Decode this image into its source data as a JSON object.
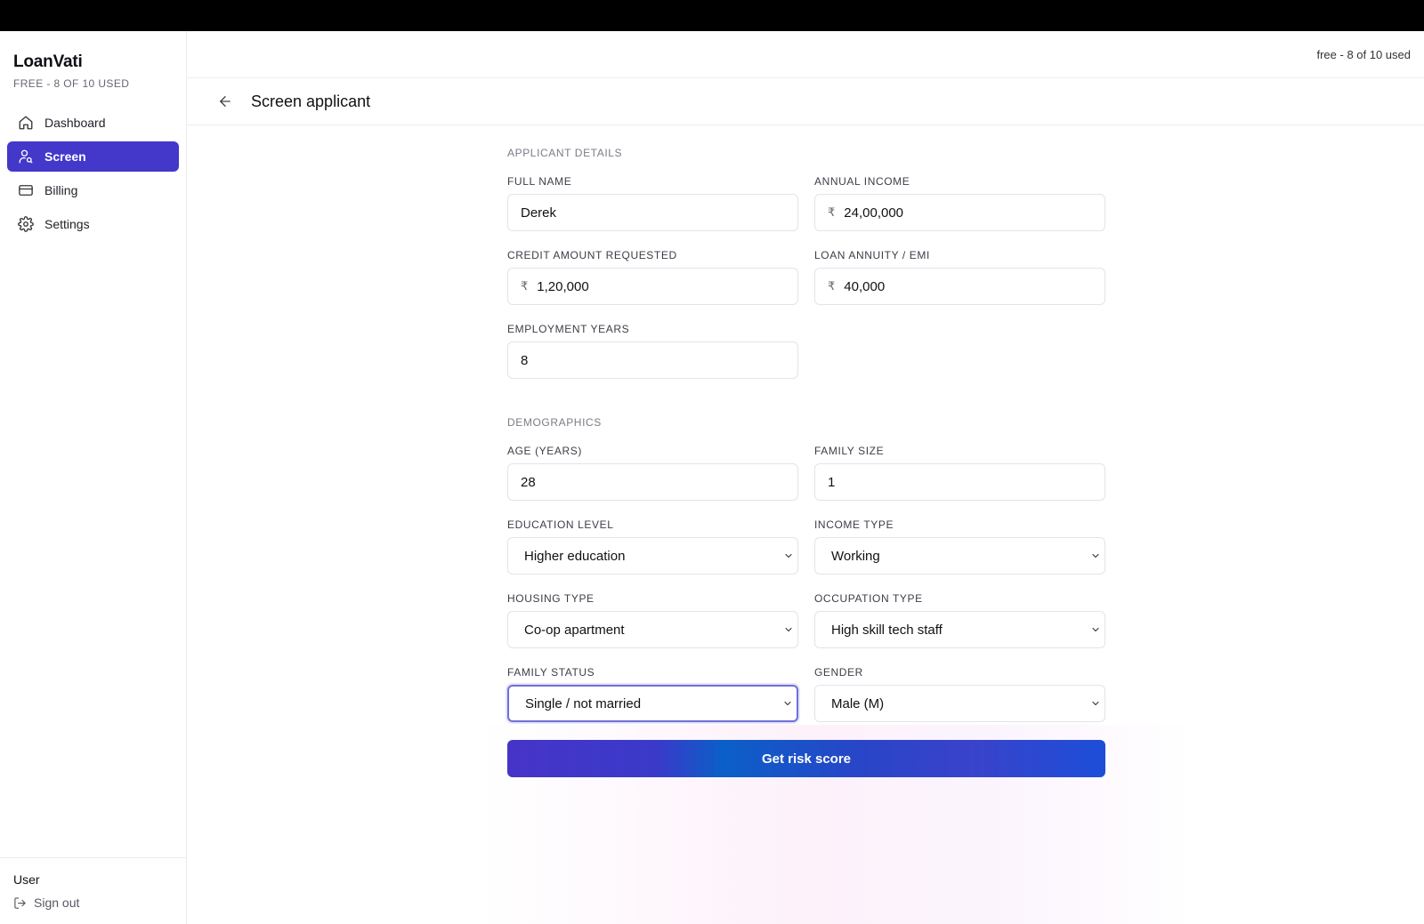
{
  "brand": {
    "name": "LoanVati",
    "plan": "FREE - 8 OF 10 USED"
  },
  "nav": [
    {
      "label": "Dashboard",
      "icon": "home-icon",
      "active": false
    },
    {
      "label": "Screen",
      "icon": "user-search-icon",
      "active": true
    },
    {
      "label": "Billing",
      "icon": "credit-card-icon",
      "active": false
    },
    {
      "label": "Settings",
      "icon": "gear-icon",
      "active": false
    }
  ],
  "sidebar_footer": {
    "user": "User",
    "signout": "Sign out"
  },
  "header": {
    "usage": "free - 8 of 10 used",
    "title": "Screen applicant"
  },
  "currency_symbol": "₹",
  "applicant": {
    "section": "APPLICANT DETAILS",
    "full_name": {
      "label": "FULL NAME",
      "value": "Derek"
    },
    "annual_income": {
      "label": "ANNUAL INCOME",
      "value": "24,00,000"
    },
    "credit_amount": {
      "label": "CREDIT AMOUNT REQUESTED",
      "value": "1,20,000"
    },
    "annuity": {
      "label": "LOAN ANNUITY / EMI",
      "value": "40,000"
    },
    "employment_years": {
      "label": "EMPLOYMENT YEARS",
      "value": "8"
    }
  },
  "demographics": {
    "section": "DEMOGRAPHICS",
    "age": {
      "label": "AGE (YEARS)",
      "value": "28"
    },
    "family_size": {
      "label": "FAMILY SIZE",
      "value": "1"
    },
    "education": {
      "label": "EDUCATION LEVEL",
      "value": "Higher education"
    },
    "income_type": {
      "label": "INCOME TYPE",
      "value": "Working"
    },
    "housing": {
      "label": "HOUSING TYPE",
      "value": "Co-op apartment"
    },
    "occupation": {
      "label": "OCCUPATION TYPE",
      "value": "High skill tech staff"
    },
    "family_status": {
      "label": "FAMILY STATUS",
      "value": "Single / not married"
    },
    "gender": {
      "label": "GENDER",
      "value": "Male (M)"
    }
  },
  "submit_label": "Get risk score",
  "colors": {
    "accent": "#4338ca",
    "focus_ring": "#6d6fd8"
  }
}
